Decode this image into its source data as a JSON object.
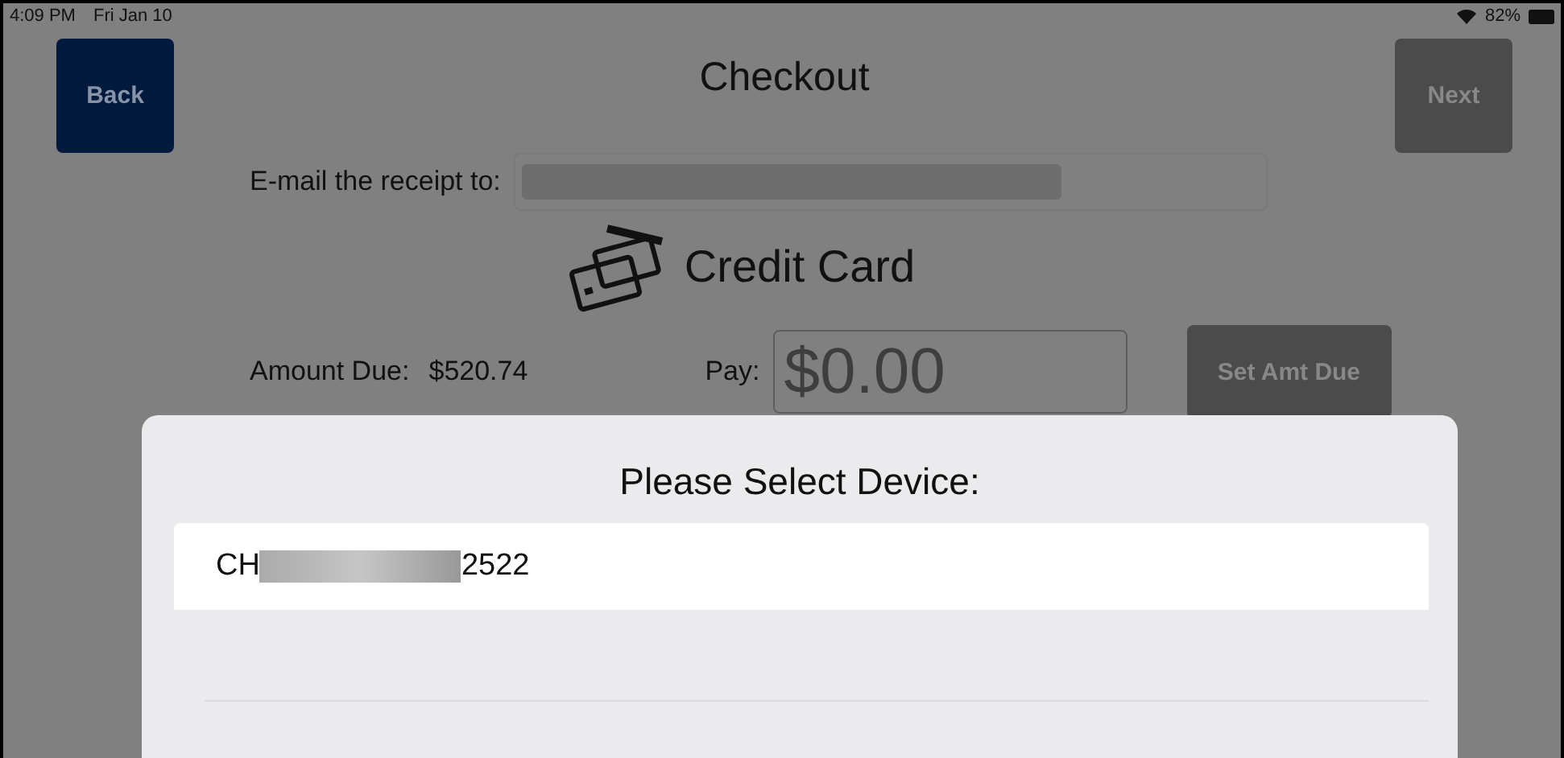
{
  "status_bar": {
    "time": "4:09 PM",
    "date": "Fri Jan 10",
    "battery": "82%"
  },
  "nav": {
    "title": "Checkout",
    "back": {
      "label": "Back",
      "disabled": false
    },
    "next": {
      "label": "Next",
      "disabled": true
    }
  },
  "email": {
    "label": "E-mail the receipt to:",
    "redacted": true
  },
  "payment_method": "Credit Card",
  "amount": {
    "label": "Amount Due:",
    "value": "$520.74",
    "pay_label": "Pay:",
    "pay_placeholder": "$0.00",
    "set_button": {
      "label": "Set Amt Due",
      "disabled": true
    }
  },
  "dialog": {
    "title": "Please Select Device:",
    "devices": [
      {
        "label_start": "CH",
        "redacted": true,
        "label_end": "2522",
        "selected": false
      }
    ]
  }
}
